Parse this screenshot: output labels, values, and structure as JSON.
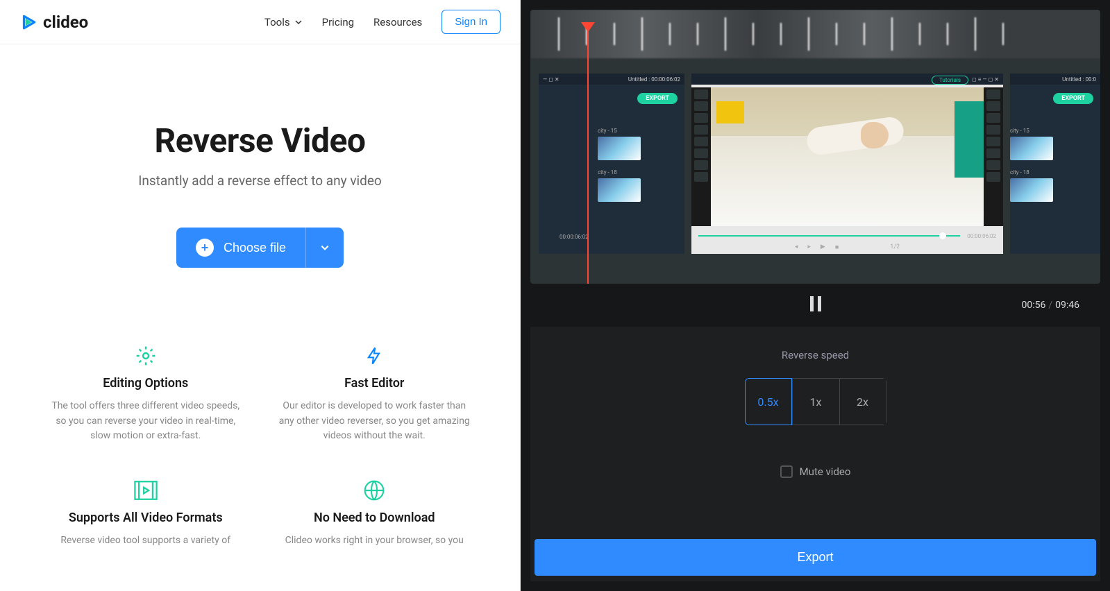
{
  "brand": "clideo",
  "nav": {
    "tools": "Tools",
    "pricing": "Pricing",
    "resources": "Resources",
    "signin": "Sign In"
  },
  "hero": {
    "title": "Reverse Video",
    "subtitle": "Instantly add a reverse effect to any video",
    "choose": "Choose file"
  },
  "features": [
    {
      "title": "Editing Options",
      "desc": "The tool offers three different video speeds, so you can reverse your video in real-time, slow motion or extra-fast."
    },
    {
      "title": "Fast Editor",
      "desc": "Our editor is developed to work faster than any other video reverser, so you get amazing videos without the wait."
    },
    {
      "title": "Supports All Video Formats",
      "desc": "Reverse video tool supports a variety of"
    },
    {
      "title": "No Need to Download",
      "desc": "Clideo works right in your browser, so you"
    }
  ],
  "preview": {
    "title1": "Untitled : 00:00:06:02",
    "title2": "Untitled : 00:0",
    "export": "EXPORT",
    "tutorials": "Tutorials",
    "thumb1": "city - 15",
    "thumb2": "city - 18",
    "ts1": "00:00:06:02",
    "ts2": "00:00:06:02",
    "fraction": "1/2"
  },
  "playback": {
    "current": "00:56",
    "total": "09:46"
  },
  "settings": {
    "speed_label": "Reverse speed",
    "speeds": [
      "0.5x",
      "1x",
      "2x"
    ],
    "mute": "Mute video"
  },
  "export_label": "Export"
}
